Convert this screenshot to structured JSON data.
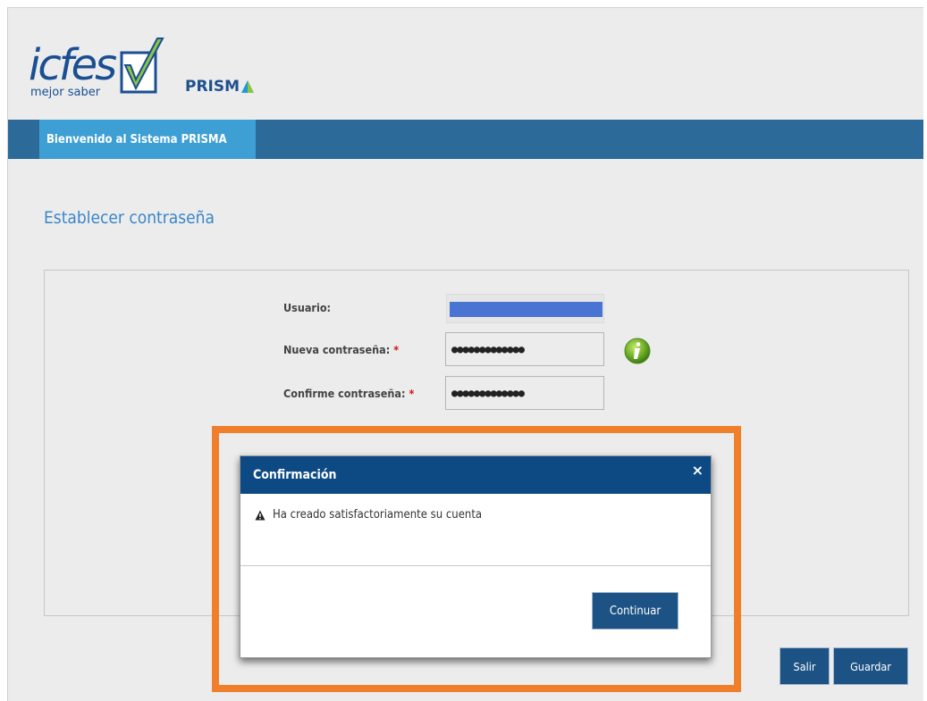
{
  "header": {
    "logo_icfes_text": "icfes",
    "logo_tagline": "mejor saber",
    "logo_prisma_text": "PRISM",
    "logo_prisma_suffix": "A"
  },
  "nav": {
    "tab_label": "Bienvenido al Sistema PRISMA"
  },
  "page": {
    "title": "Establecer contraseña"
  },
  "form": {
    "usuario_label": "Usuario:",
    "nueva_label": "Nueva contraseña:",
    "confirme_label": "Confirme contraseña:",
    "required_mark": "*",
    "nueva_value": "●●●●●●●●●●●●●",
    "confirme_value": "●●●●●●●●●●●●●",
    "info_icon": "info-icon"
  },
  "buttons": {
    "salir": "Salir",
    "guardar": "Guardar"
  },
  "modal": {
    "title": "Confirmación",
    "close_symbol": "×",
    "message": "Ha creado satisfactoriamente su cuenta",
    "continue_label": "Continuar"
  },
  "colors": {
    "nav_bar": "#2c6a99",
    "nav_tab": "#3e9fd4",
    "modal_header": "#0d4a84",
    "button": "#1c5284",
    "highlight": "#f07f2c",
    "title": "#3a86c8"
  }
}
